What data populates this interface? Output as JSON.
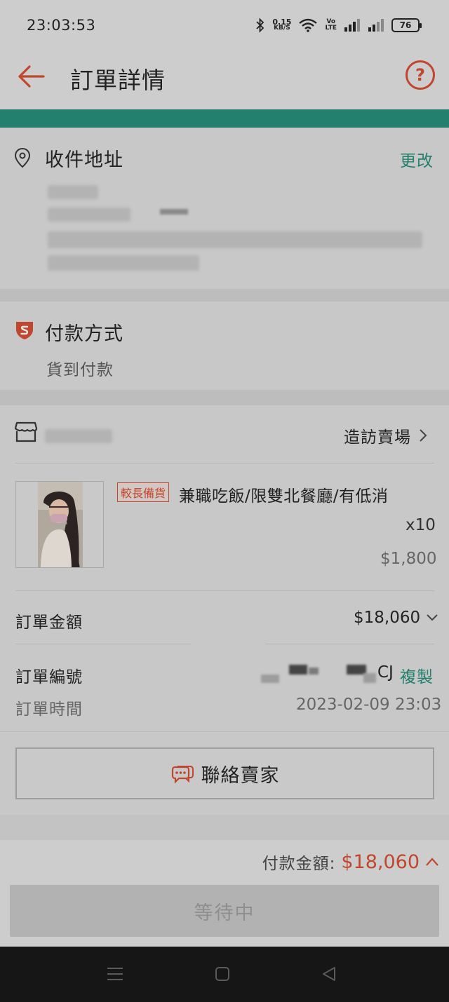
{
  "status_bar": {
    "time": "23:03:53",
    "net_speed_value": "0.15",
    "net_speed_unit": "KB/S",
    "volte_top": "Vo",
    "volte_bottom": "LTE",
    "battery": "76"
  },
  "header": {
    "title": "訂單詳情",
    "help_symbol": "?"
  },
  "address": {
    "title": "收件地址",
    "change_label": "更改"
  },
  "payment": {
    "title": "付款方式",
    "method": "貨到付款"
  },
  "shop": {
    "visit_label": "造訪賣場"
  },
  "product": {
    "tag": "較長備貨",
    "name": "兼職吃飯/限雙北餐廳/有低消",
    "quantity": "x10",
    "price": "$1,800"
  },
  "order": {
    "amount_label": "訂單金額",
    "amount_value": "$18,060",
    "number_label": "訂單編號",
    "number_suffix": "CJ",
    "copy_label": "複製",
    "time_label": "訂單時間",
    "time_value": "2023-02-09 23:03"
  },
  "contact_seller_label": "聯絡賣家",
  "footer": {
    "total_label": "付款金額:",
    "total_value": "$18,060",
    "waiting_label": "等待中"
  },
  "colors": {
    "accent": "#c0462d",
    "teal": "#23806e",
    "background": "#c9c9c9"
  },
  "icons": [
    "back-arrow-icon",
    "help-icon",
    "location-pin-icon",
    "shield-s-icon",
    "store-icon",
    "chevron-right-icon",
    "chevron-down-icon",
    "chevron-up-icon",
    "chat-bubble-icon",
    "menu-icon",
    "home-icon",
    "back-triangle-icon"
  ]
}
